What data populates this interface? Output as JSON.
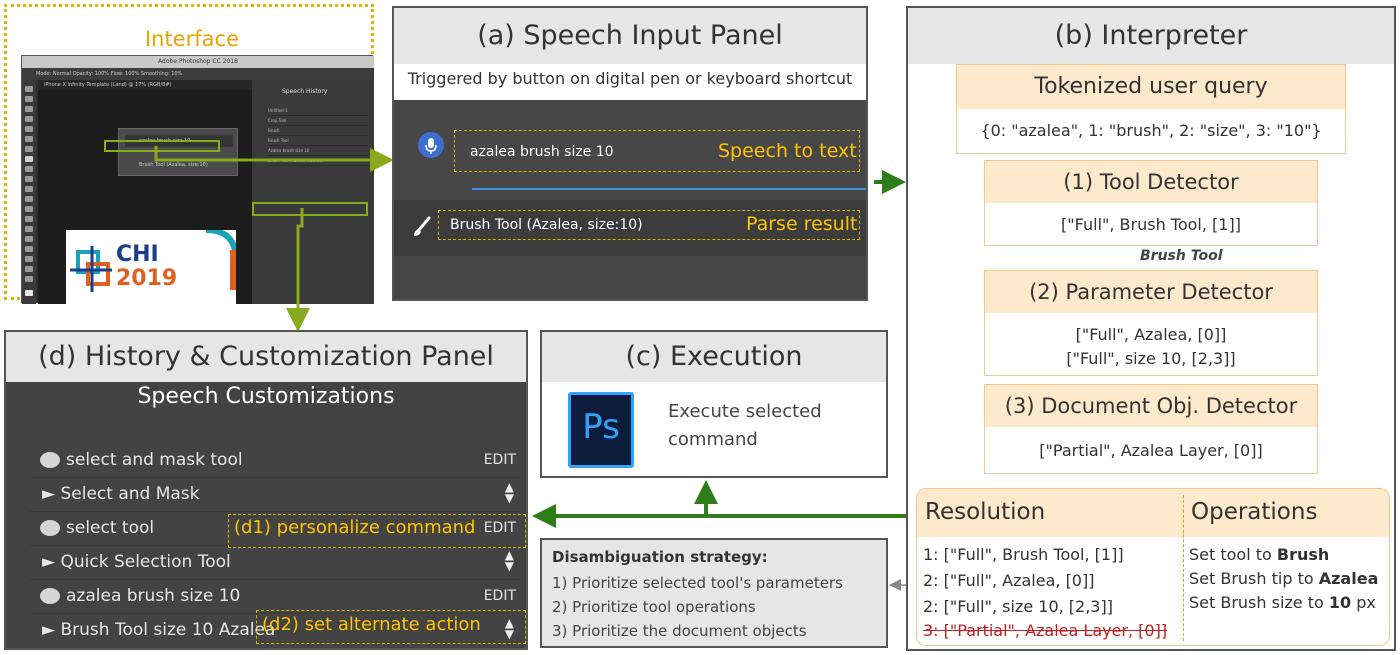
{
  "interface": {
    "title": "Interface",
    "ps_titlebar": "Adobe Photoshop CC 2018",
    "ps_options": "Mode: Normal   Opacity: 100%   Flow: 100%   Smoothing: 10%",
    "ps_tab": "iPhone X Infinity Template (Land) @ 17% (RGB/8#)",
    "popup_input": "azalea brush size 10",
    "popup_output": "Brush Tool (Azalea, size:10)",
    "history_title": "Speech History",
    "history_items": [
      "Untitled-1",
      "Crop Tool",
      "Brush",
      "Brush Tool",
      "Azalea brush size 10",
      "Brush Tool (Azalea, size:10)"
    ],
    "logo_text": "CHI",
    "logo_year": "2019"
  },
  "panel_a": {
    "title": "(a) Speech Input Panel",
    "subtitle": "Triggered by button on digital pen or keyboard shortcut",
    "speech_text": "azalea brush size 10",
    "speech_label": "Speech to text",
    "parse_text": "Brush Tool (Azalea, size:10)",
    "parse_label": "Parse result"
  },
  "panel_b": {
    "title": "(b) Interpreter",
    "tokenized_title": "Tokenized user query",
    "tokenized_value": "{0: \"azalea\", 1: \"brush\", 2: \"size\", 3: \"10\"}",
    "tool_title": "(1) Tool Detector",
    "tool_value": "[\"Full\", Brush Tool, [1]]",
    "tool_result": "Brush Tool",
    "param_title": "(2) Parameter Detector",
    "param_value_1": "[\"Full\", Azalea, [0]]",
    "param_value_2": "[\"Full\", size 10, [2,3]]",
    "doc_title": "(3) Document Obj. Detector",
    "doc_value": "[\"Partial\", Azalea Layer, [0]]",
    "resolution_title": "Resolution",
    "operations_title": "Operations",
    "resolution_items": [
      "1: [\"Full\", Brush Tool, [1]]",
      "2: [\"Full\", Azalea, [0]]",
      "2: [\"Full\", size 10, [2,3]]",
      "3: [\"Partial\", Azalea Layer, [0]]"
    ],
    "operations": [
      {
        "pre": "Set tool to ",
        "bold": "Brush",
        "post": ""
      },
      {
        "pre": "Set Brush tip to ",
        "bold": "Azalea",
        "post": ""
      },
      {
        "pre": "Set Brush size to ",
        "bold": "10",
        "post": " px"
      }
    ]
  },
  "panel_c": {
    "title": "(c) Execution",
    "logo": "Ps",
    "text": "Execute selected command"
  },
  "panel_d": {
    "title": "(d) History & Customization Panel",
    "subtitle": "Speech Customizations",
    "edit_label": "EDIT",
    "rows": [
      {
        "command": "select and mask tool",
        "action": "Select and Mask"
      },
      {
        "command": "select tool",
        "action": "Quick Selection Tool"
      },
      {
        "command": "azalea brush size 10",
        "action": "Brush Tool size 10 Azalea"
      }
    ],
    "d1_label": "(d1) personalize command",
    "d2_label": "(d2) set alternate action"
  },
  "disambiguation": {
    "title": "Disambiguation strategy:",
    "items": [
      "1) Prioritize selected tool's parameters",
      "2) Prioritize tool operations",
      "3) Prioritize the document objects"
    ]
  },
  "colors": {
    "highlight_yellow": "#ffc400",
    "arrow_green": "#2e7d1a",
    "connector_lime": "#8aaa1e",
    "orange_header": "#fde9cb",
    "orange_line": "#e8a000"
  }
}
